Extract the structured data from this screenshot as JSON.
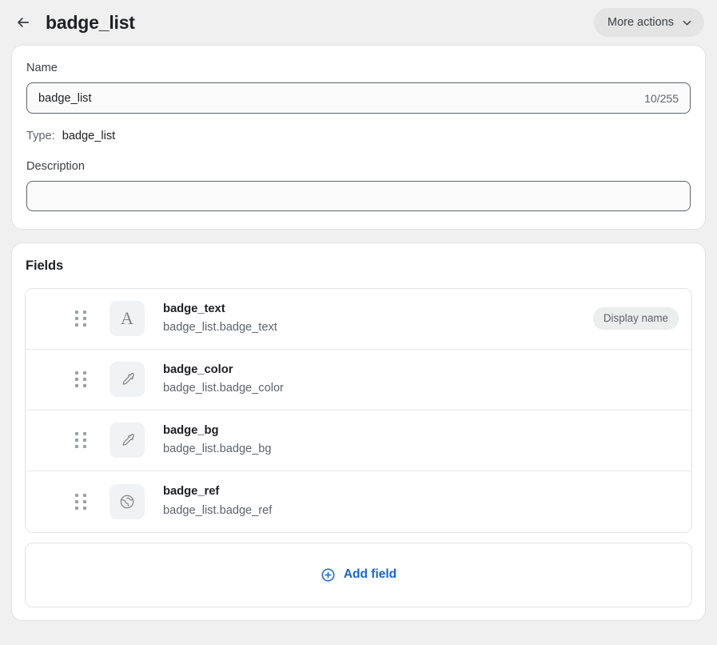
{
  "header": {
    "back_icon": "arrow-left-icon",
    "title": "badge_list",
    "more_actions_label": "More actions",
    "more_actions_icon": "chevron-down-icon"
  },
  "info_card": {
    "name_label": "Name",
    "name_value": "badge_list",
    "name_counter": "10/255",
    "type_label": "Type:",
    "type_value": "badge_list",
    "description_label": "Description",
    "description_value": "",
    "description_placeholder": ""
  },
  "fields_card": {
    "heading": "Fields",
    "rows": [
      {
        "name": "badge_text",
        "path": "badge_list.badge_text",
        "icon": "text-type-icon",
        "icon_glyph": "A",
        "badge": "Display name"
      },
      {
        "name": "badge_color",
        "path": "badge_list.badge_color",
        "icon": "eyedropper-icon",
        "icon_glyph": "",
        "badge": ""
      },
      {
        "name": "badge_bg",
        "path": "badge_list.badge_bg",
        "icon": "eyedropper-icon",
        "icon_glyph": "",
        "badge": ""
      },
      {
        "name": "badge_ref",
        "path": "badge_list.badge_ref",
        "icon": "globe-icon",
        "icon_glyph": "",
        "badge": ""
      }
    ],
    "add_field_label": "Add field",
    "add_field_icon": "plus-circle-icon"
  },
  "colors": {
    "page_bg": "#f0f0f0",
    "card_bg": "#ffffff",
    "border": "#e3e3e3",
    "text_primary": "#202124",
    "text_secondary": "#5f6368",
    "accent_link": "#1765d1",
    "badge_bg": "#eceded",
    "icon_tile_bg": "#f1f2f3",
    "input_border_focus": "#5f6368"
  }
}
